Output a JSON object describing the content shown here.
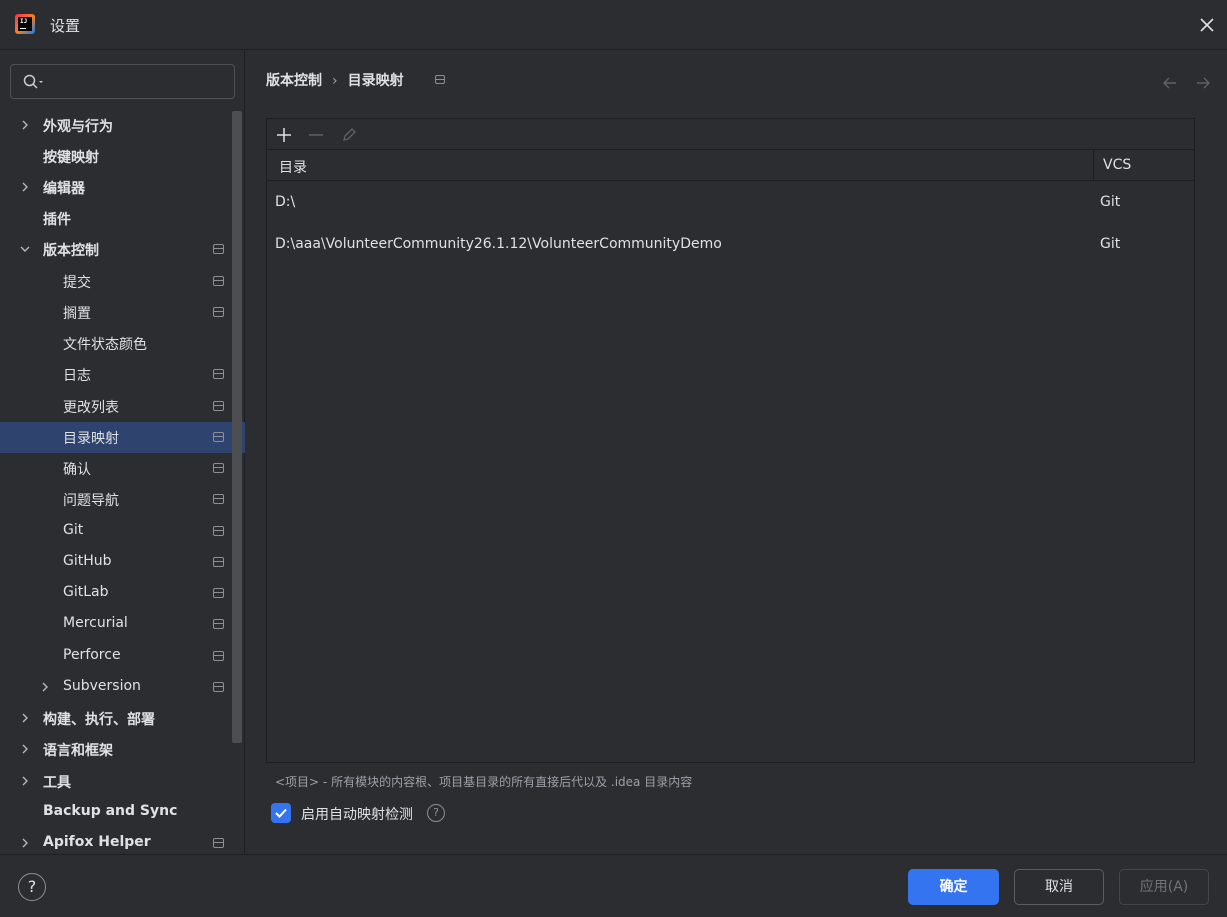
{
  "window": {
    "title": "设置",
    "logo_text": "IJ"
  },
  "sidebar": {
    "search": {
      "value": "",
      "placeholder": ""
    },
    "items": [
      {
        "label": "外观与行为",
        "bold": true
      },
      {
        "label": "按键映射",
        "bold": true
      },
      {
        "label": "编辑器",
        "bold": true
      },
      {
        "label": "插件",
        "bold": true
      },
      {
        "label": "版本控制",
        "bold": true
      },
      {
        "label": "提交"
      },
      {
        "label": "搁置"
      },
      {
        "label": "文件状态颜色"
      },
      {
        "label": "日志"
      },
      {
        "label": "更改列表"
      },
      {
        "label": "目录映射"
      },
      {
        "label": "确认"
      },
      {
        "label": "问题导航"
      },
      {
        "label": "Git"
      },
      {
        "label": "GitHub"
      },
      {
        "label": "GitLab"
      },
      {
        "label": "Mercurial"
      },
      {
        "label": "Perforce"
      },
      {
        "label": "Subversion"
      },
      {
        "label": "构建、执行、部署",
        "bold": true
      },
      {
        "label": "语言和框架",
        "bold": true
      },
      {
        "label": "工具",
        "bold": true
      },
      {
        "label": "Backup and Sync",
        "bold": true
      },
      {
        "label": "Apifox Helper",
        "bold": true
      }
    ]
  },
  "breadcrumb": {
    "parent": "版本控制",
    "separator": "›",
    "current": "目录映射"
  },
  "toolbar": {
    "add_icon": "plus-icon",
    "remove_icon": "minus-icon",
    "edit_icon": "pencil-icon"
  },
  "table": {
    "columns": [
      "目录",
      "VCS"
    ],
    "rows": [
      {
        "directory": "D:\\",
        "vcs": "Git"
      },
      {
        "directory": "D:\\aaa\\VolunteerCommunity26.1.12\\VolunteerCommunityDemo",
        "vcs": "Git"
      }
    ]
  },
  "hint": "<项目> - 所有模块的内容根、项目基目录的所有直接后代以及 .idea 目录内容",
  "auto_detect": {
    "label": "启用自动映射检测",
    "checked": true,
    "help": "?"
  },
  "footer": {
    "help": "?",
    "ok_label": "确定",
    "cancel_label": "取消",
    "apply_label": "应用(A)"
  },
  "colors": {
    "background": "#2b2d30",
    "accent": "#3574f0",
    "selection": "#2e436e",
    "text": "#dfe1e5"
  }
}
